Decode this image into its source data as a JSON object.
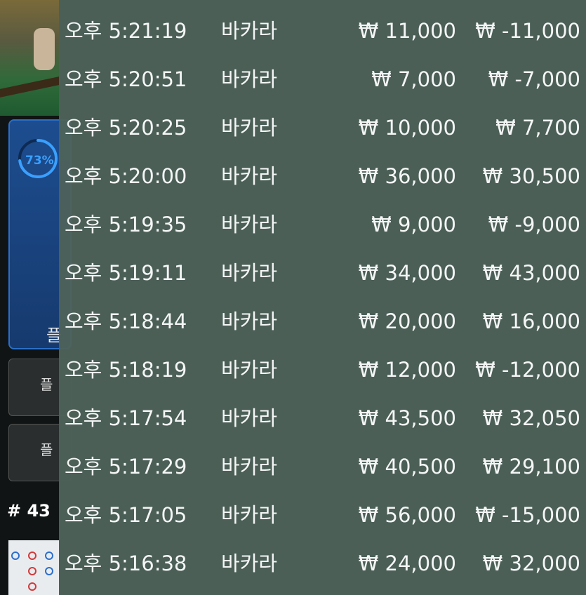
{
  "game_panel": {
    "progress_percent": 73,
    "progress_label": "73%",
    "panel_partial_label": "플",
    "button_1_partial": "플",
    "button_2_partial": "플",
    "round_label": "# 43"
  },
  "colors": {
    "overlay": "#4e625a",
    "text": "#f4f6f5",
    "accent_blue": "#3aa0ff"
  },
  "history": {
    "rows": [
      {
        "time": "오후 5:21:19",
        "game": "바카라",
        "bet": "₩ 11,000",
        "result": "₩ -11,000"
      },
      {
        "time": "오후 5:20:51",
        "game": "바카라",
        "bet": "₩ 7,000",
        "result": "₩ -7,000"
      },
      {
        "time": "오후 5:20:25",
        "game": "바카라",
        "bet": "₩ 10,000",
        "result": "₩ 7,700"
      },
      {
        "time": "오후 5:20:00",
        "game": "바카라",
        "bet": "₩ 36,000",
        "result": "₩ 30,500"
      },
      {
        "time": "오후 5:19:35",
        "game": "바카라",
        "bet": "₩ 9,000",
        "result": "₩ -9,000"
      },
      {
        "time": "오후 5:19:11",
        "game": "바카라",
        "bet": "₩ 34,000",
        "result": "₩ 43,000"
      },
      {
        "time": "오후 5:18:44",
        "game": "바카라",
        "bet": "₩ 20,000",
        "result": "₩ 16,000"
      },
      {
        "time": "오후 5:18:19",
        "game": "바카라",
        "bet": "₩ 12,000",
        "result": "₩ -12,000"
      },
      {
        "time": "오후 5:17:54",
        "game": "바카라",
        "bet": "₩ 43,500",
        "result": "₩ 32,050"
      },
      {
        "time": "오후 5:17:29",
        "game": "바카라",
        "bet": "₩ 40,500",
        "result": "₩ 29,100"
      },
      {
        "time": "오후 5:17:05",
        "game": "바카라",
        "bet": "₩ 56,000",
        "result": "₩ -15,000"
      },
      {
        "time": "오후 5:16:38",
        "game": "바카라",
        "bet": "₩ 24,000",
        "result": "₩ 32,000"
      }
    ]
  }
}
